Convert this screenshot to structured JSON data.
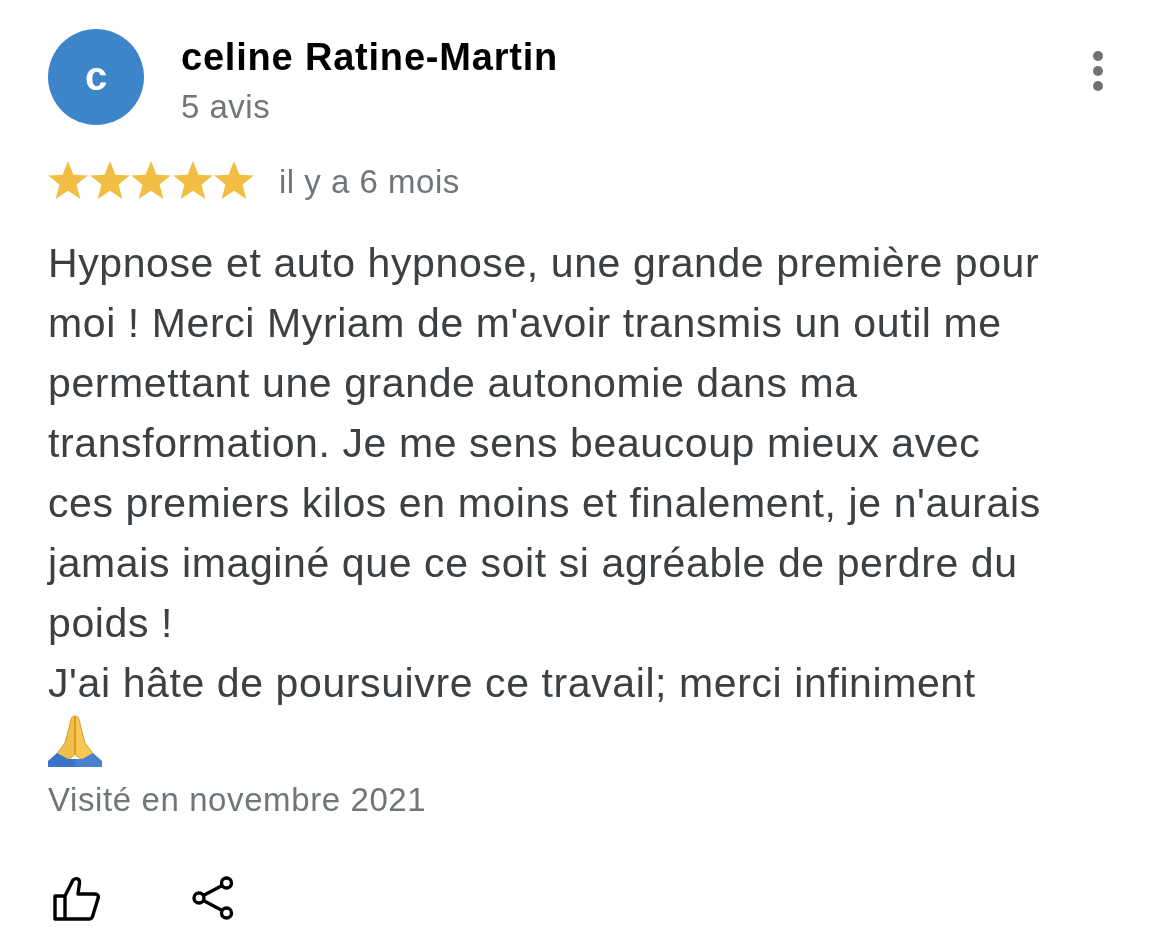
{
  "reviewer": {
    "initial": "c",
    "name": "celine Ratine-Martin",
    "review_count": "5 avis"
  },
  "review": {
    "stars": 5,
    "time": "il y a 6 mois",
    "text": "Hypnose et auto hypnose, une grande première pour moi ! Merci Myriam de m'avoir transmis un outil me permettant une grande autonomie dans ma transformation. Je me sens beaucoup mieux avec ces premiers kilos en moins et finalement, je n'aurais jamais imaginé que ce soit si agréable de perdre du poids !\nJ'ai hâte de poursuivre ce travail; merci infiniment",
    "visited": "Visité en novembre 2021"
  }
}
